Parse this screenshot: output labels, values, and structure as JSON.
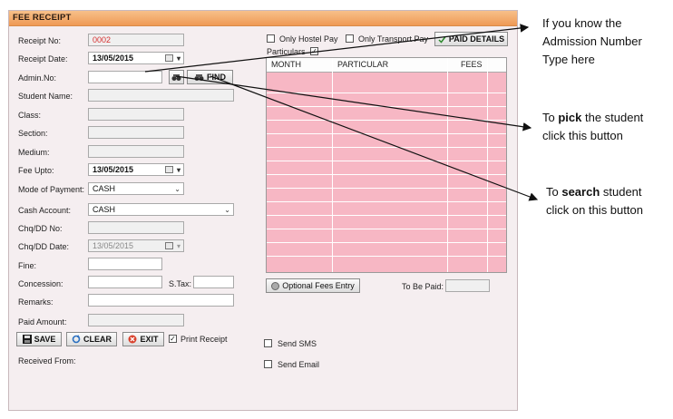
{
  "title": "FEE RECEIPT",
  "receipt_no": {
    "label": "Receipt No:",
    "value": "0002"
  },
  "receipt_date": {
    "label": "Receipt Date:",
    "value": "13/05/2015"
  },
  "admin_no": {
    "label": "Admin.No:",
    "value": ""
  },
  "find_button": "FIND",
  "student_name": {
    "label": "Student Name:"
  },
  "class": {
    "label": "Class:"
  },
  "section": {
    "label": "Section:"
  },
  "medium": {
    "label": "Medium:"
  },
  "fee_upto": {
    "label": "Fee Upto:",
    "value": "13/05/2015"
  },
  "mode_of_payment": {
    "label": "Mode of Payment:",
    "value": "CASH"
  },
  "cash_account": {
    "label": "Cash Account:",
    "value": "CASH"
  },
  "chq_dd_no": {
    "label": "Chq/DD No:"
  },
  "chq_dd_date": {
    "label": "Chq/DD Date:",
    "value": "13/05/2015"
  },
  "fine": {
    "label": "Fine:"
  },
  "concession": {
    "label": "Concession:"
  },
  "stax": {
    "label": "S.Tax:"
  },
  "remarks": {
    "label": "Remarks:"
  },
  "paid_amount": {
    "label": "Paid Amount:"
  },
  "buttons": {
    "save": "SAVE",
    "clear": "CLEAR",
    "exit": "EXIT"
  },
  "print_receipt": {
    "label": "Print Receipt",
    "checked": true
  },
  "received_from": "Received From:",
  "only_hostel_pay": "Only Hostel Pay",
  "only_transport_pay": "Only Transport Pay",
  "paid_details": "PAID DETAILS",
  "particulars": {
    "label": "Particulars",
    "checked": true
  },
  "grid_columns": [
    "MONTH",
    "PARTICULAR",
    "FEES"
  ],
  "optional_fees_entry": "Optional Fees Entry",
  "to_be_paid": "To Be Paid:",
  "send_sms": "Send SMS",
  "send_email": "Send Email",
  "annotations": {
    "admission_lines": [
      "If you know the",
      "Admission Number",
      "Type here"
    ],
    "pick_prefix": "To ",
    "pick_bold": "pick",
    "pick_suffix": " the student",
    "pick_line2": "click this button",
    "search_prefix": "To ",
    "search_bold": "search",
    "search_suffix": " student",
    "search_line2": "click on this button"
  },
  "colors": {
    "grid_bg": "#f7b7c4",
    "title_bg": "#ef9a55",
    "receipt_no_text": "#d63030"
  }
}
